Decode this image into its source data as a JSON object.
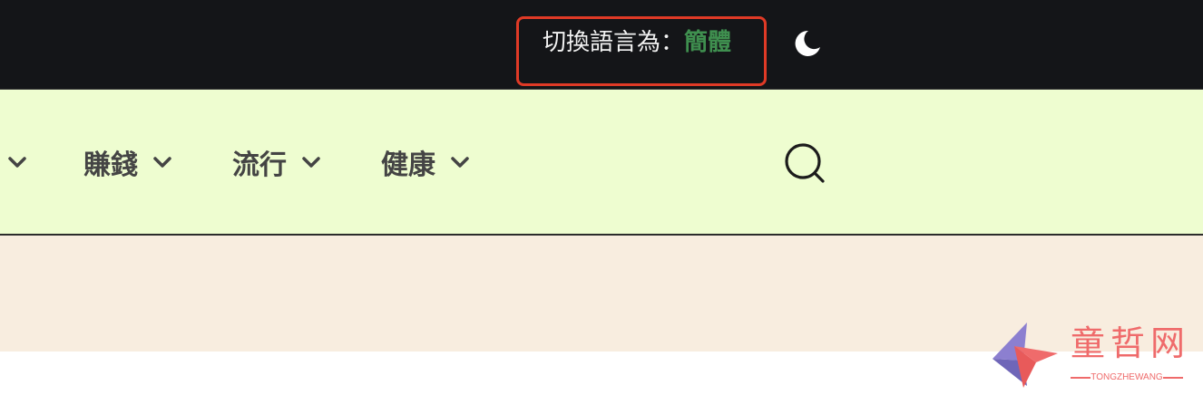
{
  "topbar": {
    "lang_prefix": "切換語言為：",
    "lang_link": "簡體",
    "dark_mode_icon": "moon-icon",
    "highlight_color": "#e03a26",
    "link_color": "#3f8f4f"
  },
  "nav": {
    "items": [
      {
        "label": "賺錢"
      },
      {
        "label": "流行"
      },
      {
        "label": "健康"
      }
    ],
    "search_icon": "search-icon",
    "background": "#eefdd0"
  },
  "watermark": {
    "name_cn": "童哲网",
    "name_en": "TONGZHEWANG"
  }
}
